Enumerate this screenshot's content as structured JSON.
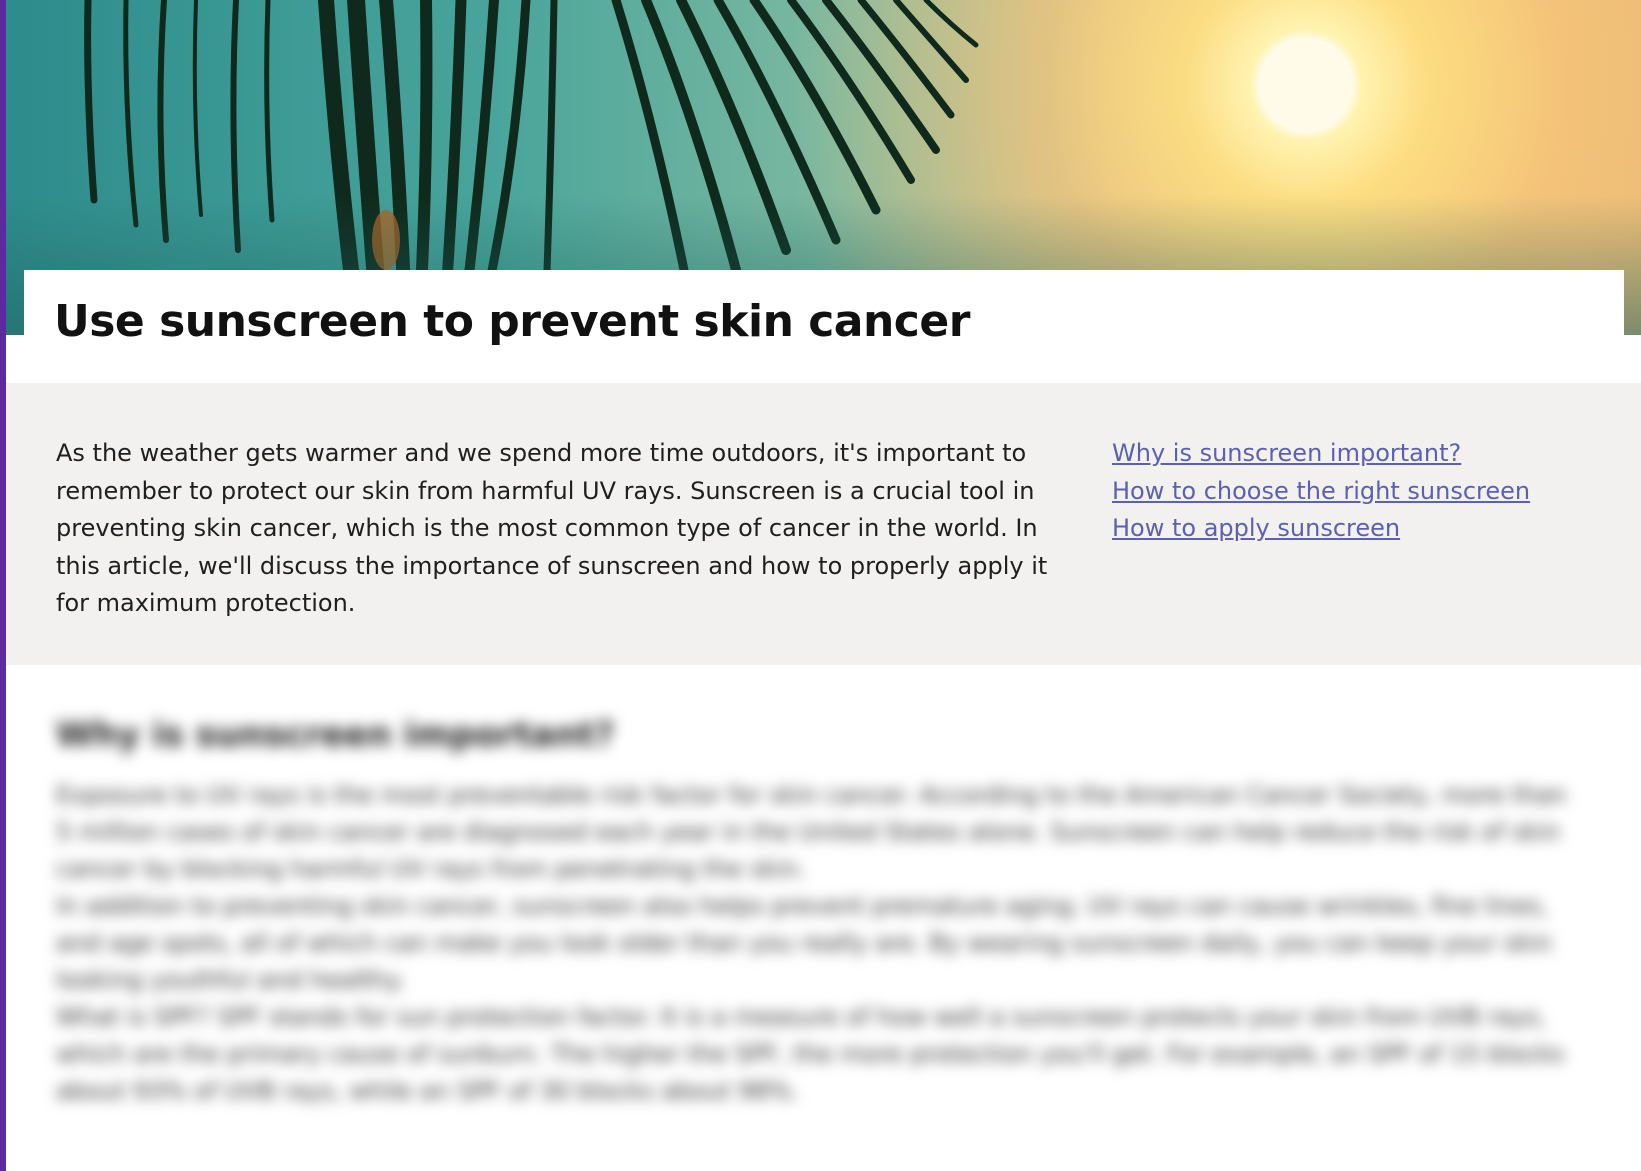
{
  "article": {
    "title": "Use sunscreen to prevent skin cancer",
    "intro": "As the weather gets warmer and we spend more time outdoors, it's important to remember to protect our skin from harmful UV rays. Sunscreen is a crucial tool in preventing skin cancer, which is the most common type of cancer in the world. In this article, we'll discuss the importance of sunscreen and how to properly apply it for maximum protection.",
    "toc": [
      {
        "label": "Why is sunscreen important?"
      },
      {
        "label": "How to choose the right sunscreen"
      },
      {
        "label": "How to apply sunscreen"
      }
    ],
    "section": {
      "heading": "Why is sunscreen important?",
      "paragraphs": [
        "Exposure to UV rays is the most preventable risk factor for skin cancer. According to the American Cancer Society, more than 5 million cases of skin cancer are diagnosed each year in the United States alone. Sunscreen can help reduce the risk of skin cancer by blocking harmful UV rays from penetrating the skin.",
        "In addition to preventing skin cancer, sunscreen also helps prevent premature aging. UV rays can cause wrinkles, fine lines, and age spots, all of which can make you look older than you really are. By wearing sunscreen daily, you can keep your skin looking youthful and healthy.",
        "What is SPF? SPF stands for sun protection factor. It is a measure of how well a sunscreen protects your skin from UVB rays, which are the primary cause of sunburn. The higher the SPF, the more protection you'll get. For example, an SPF of 15 blocks about 93% of UVB rays, while an SPF of 30 blocks about 98%."
      ]
    }
  },
  "hero": {
    "image": "palm-fronds-at-sunset",
    "colors": {
      "sky_left": "#2d8c8c",
      "sky_right": "#f2c47e",
      "sun": "#fffbe8",
      "fronds": "#0f2a1c"
    }
  },
  "colors": {
    "accent": "#5a2a9e",
    "link": "#5b5fb5",
    "summary_bg": "#f2f1f0"
  }
}
